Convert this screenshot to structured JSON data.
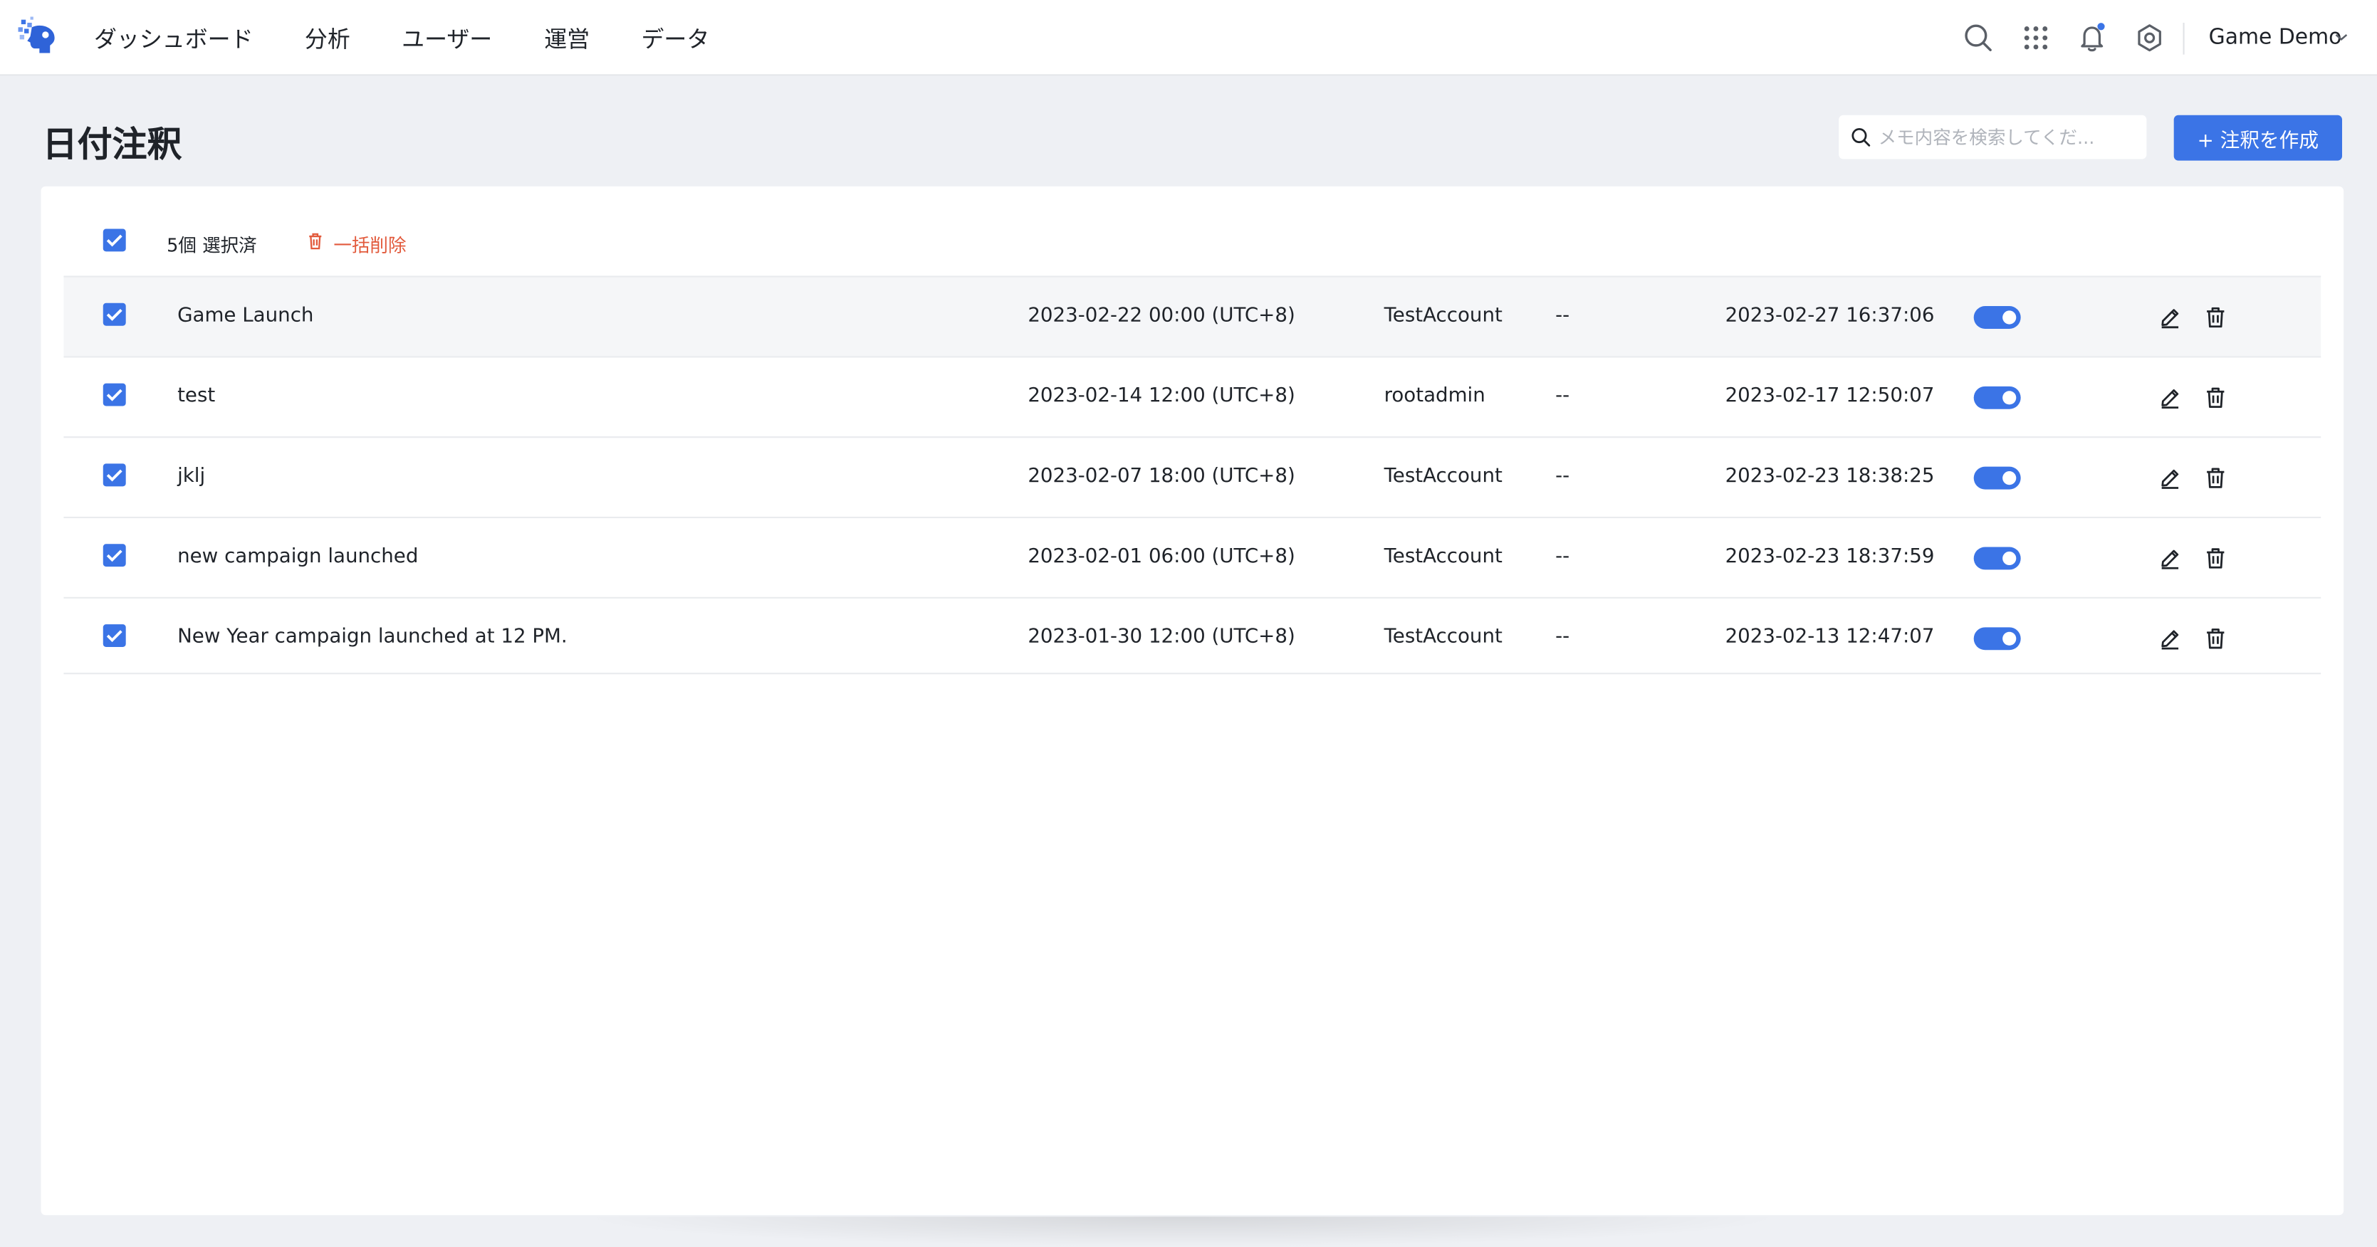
{
  "nav": {
    "items": [
      "ダッシュボード",
      "分析",
      "ユーザー",
      "運営",
      "データ"
    ]
  },
  "header_right": {
    "project_name": "Game Demo",
    "icons": [
      "search-icon",
      "apps-grid-icon",
      "bell-icon",
      "settings-icon",
      "chevron-down-icon"
    ],
    "notification_dot": true
  },
  "page": {
    "title": "日付注釈",
    "search_placeholder": "メモ内容を検索してくだ...",
    "search_value": "",
    "create_button": "+ 注釈を作成"
  },
  "selection": {
    "all_checked": true,
    "count_label": "5個 選択済",
    "bulk_delete_label": "一括削除"
  },
  "rows": [
    {
      "title": "Game Launch",
      "date": "2023-02-22 00:00 (UTC+8)",
      "creator": "TestAccount",
      "note": "--",
      "updated": "2023-02-27 16:37:06",
      "enabled": true,
      "checked": true,
      "highlighted": true
    },
    {
      "title": "test",
      "date": "2023-02-14 12:00 (UTC+8)",
      "creator": "rootadmin",
      "note": "--",
      "updated": "2023-02-17 12:50:07",
      "enabled": true,
      "checked": true,
      "highlighted": false
    },
    {
      "title": "jklj",
      "date": "2023-02-07 18:00 (UTC+8)",
      "creator": "TestAccount",
      "note": "--",
      "updated": "2023-02-23 18:38:25",
      "enabled": true,
      "checked": true,
      "highlighted": false
    },
    {
      "title": "new campaign launched",
      "date": "2023-02-01 06:00 (UTC+8)",
      "creator": "TestAccount",
      "note": "--",
      "updated": "2023-02-23 18:37:59",
      "enabled": true,
      "checked": true,
      "highlighted": false
    },
    {
      "title": "New Year campaign launched at 12 PM.",
      "date": "2023-01-30 12:00 (UTC+8)",
      "creator": "TestAccount",
      "note": "--",
      "updated": "2023-02-13 12:47:07",
      "enabled": true,
      "checked": true,
      "highlighted": false
    }
  ],
  "colors": {
    "accent": "#3b74e6",
    "danger": "#e25a3c",
    "background": "#eef0f4"
  }
}
